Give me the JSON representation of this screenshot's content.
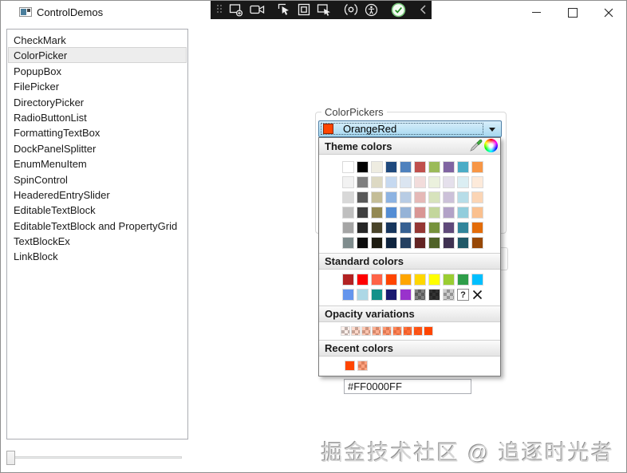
{
  "window": {
    "title": "ControlDemos",
    "controls": [
      "minimize",
      "maximize",
      "close"
    ]
  },
  "capture_toolbar": {
    "background": "#181818",
    "icons": [
      "grip-handle",
      "region-capture",
      "video-camera",
      "cursor-flag-select",
      "nested-rectangle-select",
      "window-cursor-select",
      "gear-parentheses",
      "accessibility",
      "confirm-check",
      "collapse-left"
    ]
  },
  "sidebar": {
    "items": [
      {
        "label": "CheckMark",
        "selected": false
      },
      {
        "label": "ColorPicker",
        "selected": true
      },
      {
        "label": "PopupBox",
        "selected": false
      },
      {
        "label": "FilePicker",
        "selected": false
      },
      {
        "label": "DirectoryPicker",
        "selected": false
      },
      {
        "label": "RadioButtonList",
        "selected": false
      },
      {
        "label": "FormattingTextBox",
        "selected": false
      },
      {
        "label": "DockPanelSplitter",
        "selected": false
      },
      {
        "label": "EnumMenuItem",
        "selected": false
      },
      {
        "label": "SpinControl",
        "selected": false
      },
      {
        "label": "HeaderedEntrySlider",
        "selected": false
      },
      {
        "label": "EditableTextBlock",
        "selected": false
      },
      {
        "label": "EditableTextBlock and PropertyGrid",
        "selected": false
      },
      {
        "label": "TextBlockEx",
        "selected": false
      },
      {
        "label": "LinkBlock",
        "selected": false
      }
    ]
  },
  "main": {
    "groupbox_label": "ColorPickers",
    "combobox": {
      "value": "OrangeRed",
      "swatch_color": "#FF4500"
    },
    "hex_input": {
      "value": "#FF0000FF"
    }
  },
  "palettes": {
    "theme": {
      "title": "Theme colors",
      "rows": [
        [
          "#FFFFFF",
          "#000000",
          "#EEECE1",
          "#1F497D",
          "#4F81BD",
          "#C0504D",
          "#9BBB59",
          "#8064A2",
          "#4BACC6",
          "#F79646"
        ],
        [
          "#F2F2F2",
          "#7F7F7F",
          "#DDD9C3",
          "#C6D9F0",
          "#DBE5F1",
          "#F2DCDB",
          "#EBF1DD",
          "#E5E0EC",
          "#DBEEF3",
          "#FDEADA"
        ],
        [
          "#D8D8D8",
          "#595959",
          "#C4BD97",
          "#8DB3E2",
          "#B8CCE4",
          "#E5B9B7",
          "#D7E3BC",
          "#CCC1D9",
          "#B7DDE8",
          "#FBD5B5"
        ],
        [
          "#BFBFBF",
          "#3F3F3F",
          "#938953",
          "#548DD4",
          "#95B3D7",
          "#D99694",
          "#C3D69B",
          "#B2A2C7",
          "#92CDDC",
          "#FAC08F"
        ],
        [
          "#A5A5A5",
          "#262626",
          "#494429",
          "#17365D",
          "#366092",
          "#953734",
          "#76923C",
          "#5F497A",
          "#31859B",
          "#E36C09"
        ],
        [
          "#7F8C8D",
          "#0C0C0C",
          "#1D1B10",
          "#0F243E",
          "#244061",
          "#632423",
          "#4F6228",
          "#3F3151",
          "#205867",
          "#974806"
        ]
      ]
    },
    "standard": {
      "title": "Standard colors",
      "rows": [
        [
          "#B22222",
          "#FF0000",
          "#FF6347",
          "#FF4500",
          "#FFA500",
          "#FFD700",
          "#FFFF00",
          "#9ACD32",
          "#2E9E49",
          "#00BFFF"
        ],
        [
          "#6495ED",
          "#ADD8E6",
          "#12918A",
          "#191970",
          "#9932CC",
          {
            "c": "#000000",
            "a": 0.5
          },
          {
            "c": "#000000",
            "a": 0.8
          },
          {
            "c": "#000000",
            "a": 0.2
          },
          {
            "t": "q"
          },
          {
            "t": "x"
          }
        ]
      ]
    },
    "opacity": {
      "title": "Opacity variations",
      "rows": [
        [
          {
            "c": "#FF4500",
            "a": 0.08
          },
          {
            "c": "#FF4500",
            "a": 0.2
          },
          {
            "c": "#FF4500",
            "a": 0.3
          },
          {
            "c": "#FF4500",
            "a": 0.42
          },
          {
            "c": "#FF4500",
            "a": 0.55
          },
          {
            "c": "#FF4500",
            "a": 0.65
          },
          {
            "c": "#FF4500",
            "a": 0.78
          },
          {
            "c": "#FF4500",
            "a": 0.9
          },
          "#FF4500"
        ]
      ]
    },
    "recent": {
      "title": "Recent colors",
      "rows": [
        [
          "#FF4500",
          {
            "c": "#FF4500",
            "a": 0.5
          }
        ]
      ]
    }
  },
  "watermark": {
    "text": "掘金技术社区 @ 追逐时光者"
  }
}
